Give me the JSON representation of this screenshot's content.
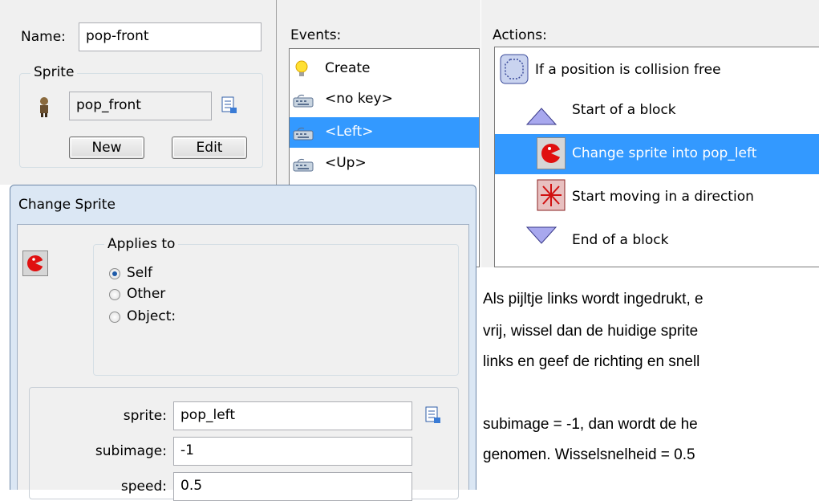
{
  "object_panel": {
    "name_label": "Name:",
    "name_value": "pop-front",
    "sprite_group_label": "Sprite",
    "sprite_value": "pop_front",
    "new_button": "New",
    "edit_button": "Edit"
  },
  "events": {
    "label": "Events:",
    "items": [
      {
        "label": "Create",
        "icon": "lightbulb-icon"
      },
      {
        "label": "<no key>",
        "icon": "keyboard-icon"
      },
      {
        "label": "<Left>",
        "icon": "keyboard-icon",
        "selected": true
      },
      {
        "label": "<Up>",
        "icon": "keyboard-icon"
      }
    ]
  },
  "actions": {
    "label": "Actions:",
    "items": [
      {
        "label": "If a position is collision free",
        "icon": "octagon-icon"
      },
      {
        "label": "Start of a block",
        "icon": "triangle-up-icon"
      },
      {
        "label": "Change sprite into pop_left",
        "icon": "pacman-icon",
        "selected": true
      },
      {
        "label": "Start moving in a direction",
        "icon": "direction-arrows-icon"
      },
      {
        "label": "End of a block",
        "icon": "triangle-down-icon"
      }
    ]
  },
  "dialog": {
    "title": "Change Sprite",
    "applies_to_label": "Applies to",
    "options": [
      "Self",
      "Other",
      "Object:"
    ],
    "selected_option": "Self",
    "sprite_label": "sprite:",
    "sprite_value": "pop_left",
    "subimage_label": "subimage:",
    "subimage_value": "-1",
    "speed_label": "speed:",
    "speed_value": "0.5"
  },
  "description": {
    "line1": "Als pijltje links wordt ingedrukt, e",
    "line2": "vrij, wissel dan de huidige sprite",
    "line3": "links en geef de richting en snell",
    "line4": "subimage = -1, dan wordt de he",
    "line5": "genomen. Wisselsnelheid = 0.5"
  },
  "colors": {
    "selection": "#3399ff",
    "dialog_title": "#dbe7f4"
  }
}
